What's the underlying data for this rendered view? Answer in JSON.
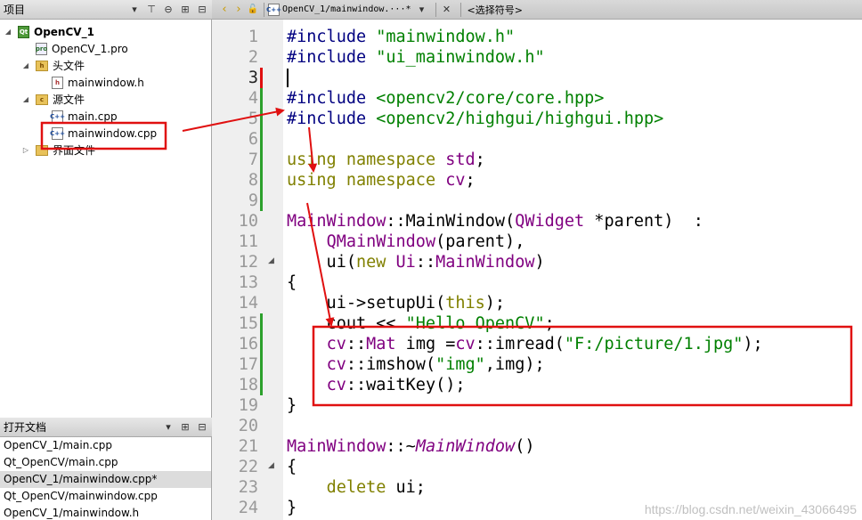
{
  "left_panel": {
    "title": "项目",
    "tree": [
      {
        "label": "OpenCV_1",
        "type": "project"
      },
      {
        "label": "OpenCV_1.pro",
        "type": "pro"
      },
      {
        "label": "头文件",
        "type": "folder"
      },
      {
        "label": "mainwindow.h",
        "type": "h"
      },
      {
        "label": "源文件",
        "type": "folder"
      },
      {
        "label": "main.cpp",
        "type": "cpp"
      },
      {
        "label": "mainwindow.cpp",
        "type": "cpp"
      },
      {
        "label": "界面文件",
        "type": "folder"
      }
    ]
  },
  "open_docs": {
    "title": "打开文档",
    "items": [
      "OpenCV_1/main.cpp",
      "Qt_OpenCV/main.cpp",
      "OpenCV_1/mainwindow.cpp*",
      "Qt_OpenCV/mainwindow.cpp",
      "OpenCV_1/mainwindow.h"
    ]
  },
  "editor": {
    "file_label": "OpenCV_1/mainwindow.···*",
    "symbol_label": "<选择符号>",
    "line_numbers": [
      "1",
      "2",
      "3",
      "4",
      "5",
      "6",
      "7",
      "8",
      "9",
      "10",
      "11",
      "12",
      "13",
      "14",
      "15",
      "16",
      "17",
      "18",
      "19",
      "20",
      "21",
      "22",
      "23",
      "24"
    ]
  },
  "code": {
    "l1a": "#include ",
    "l1b": "\"mainwindow.h\"",
    "l2a": "#include ",
    "l2b": "\"ui_mainwindow.h\"",
    "l4a": "#include ",
    "l4b": "<opencv2/core/core.hpp>",
    "l5a": "#include ",
    "l5b": "<opencv2/highgui/highgui.hpp>",
    "l7a": "using",
    "l7b": " namespace",
    "l7c": " std",
    "l7d": ";",
    "l8a": "using",
    "l8b": " namespace",
    "l8c": " cv",
    "l8d": ";",
    "l10a": "MainWindow",
    "l10b": "::",
    "l10c": "MainWindow",
    "l10d": "(",
    "l10e": "QWidget",
    "l10f": " *parent)  :",
    "l11a": "    ",
    "l11b": "QMainWindow",
    "l11c": "(parent),",
    "l12a": "    ui(",
    "l12b": "new",
    "l12c": " ",
    "l12d": "Ui",
    "l12e": "::",
    "l12f": "MainWindow",
    "l12g": ")",
    "l13": "{",
    "l14a": "    ui->setupUi(",
    "l14b": "this",
    "l14c": ");",
    "l15a": "    cout << ",
    "l15b": "\"Hello OpenCV\"",
    "l15c": ";",
    "l16a": "    ",
    "l16b": "cv",
    "l16c": "::",
    "l16d": "Mat",
    "l16e": " img =",
    "l16f": "cv",
    "l16g": "::imread(",
    "l16h": "\"F:/picture/1.jpg\"",
    "l16i": ");",
    "l17a": "    ",
    "l17b": "cv",
    "l17c": "::imshow(",
    "l17d": "\"img\"",
    "l17e": ",img);",
    "l18a": "    ",
    "l18b": "cv",
    "l18c": "::waitKey();",
    "l19": "}",
    "l21a": "MainWindow",
    "l21b": "::~",
    "l21c": "MainWindow",
    "l21d": "()",
    "l22": "{",
    "l23a": "    ",
    "l23b": "delete",
    "l23c": " ui;",
    "l24": "}"
  },
  "watermark": "https://blog.csdn.net/weixin_43066495",
  "colors": {
    "annotation_red": "#e01010",
    "preprocessor": "#000080",
    "string": "#008000",
    "keyword": "#808000",
    "type": "#800080",
    "changed_line": "#2ca02c"
  }
}
